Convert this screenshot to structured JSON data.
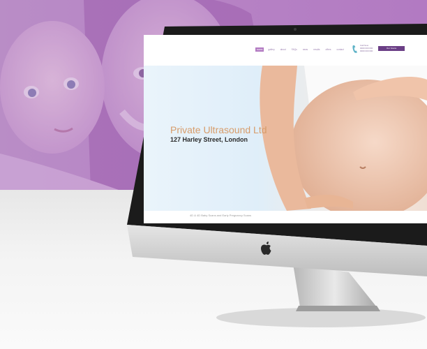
{
  "website": {
    "nav_items": [
      "scans",
      "gallery",
      "about",
      "FAQs",
      "news",
      "results",
      "offers",
      "contact"
    ],
    "phone_label": "Call Now",
    "phone_lines": [
      "0000 000 000",
      "0000 000 000"
    ],
    "cta_label": "Our Scans",
    "hero_title": "Private Ultrasound Ltd",
    "hero_subtitle": "127 Harley Street, London",
    "below_text": "4D & 4D Baby Scans and Early Pregnancy Scans"
  },
  "colors": {
    "brand_purple": "#b27ac2",
    "hero_title_color": "#d79c6a",
    "cta_color": "#6b3f86"
  },
  "icons": [
    "phone-icon",
    "apple-logo-icon"
  ]
}
